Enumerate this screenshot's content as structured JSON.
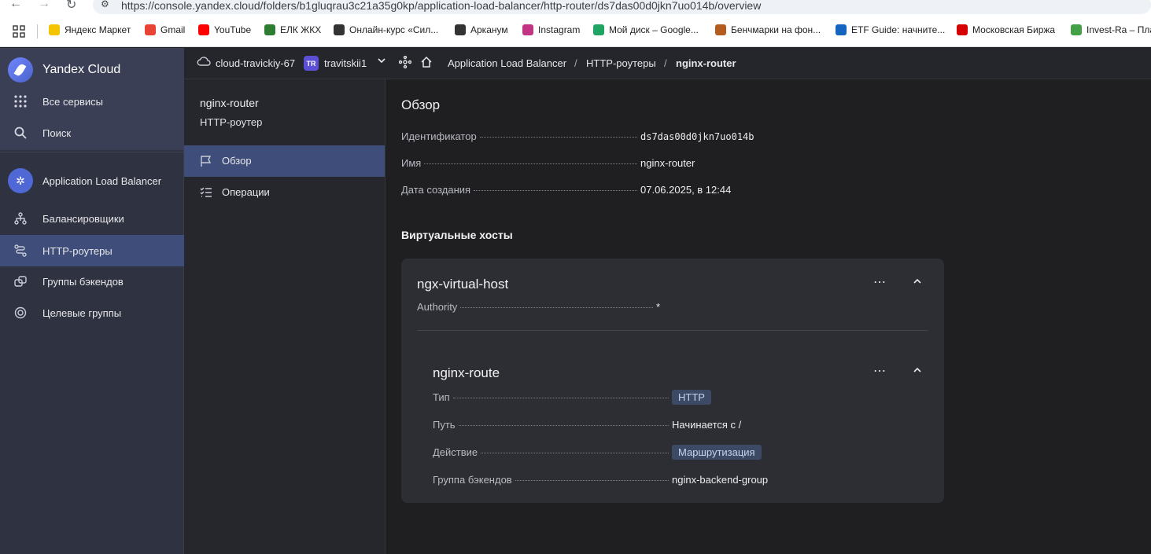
{
  "browser": {
    "url": "https://console.yandex.cloud/folders/b1gluqrau3c21a35g0kp/application-load-balancer/http-router/ds7das00d0jkn7uo014b/overview",
    "bookmarks": [
      {
        "label": "Яндекс Маркет",
        "icon": "yandex-market-icon",
        "color": "#f5c400"
      },
      {
        "label": "Gmail",
        "icon": "gmail-icon",
        "color": "#ea4335"
      },
      {
        "label": "YouTube",
        "icon": "youtube-icon",
        "color": "#ff0000"
      },
      {
        "label": "ЕЛК ЖКХ",
        "icon": "elk-icon",
        "color": "#2e7d32"
      },
      {
        "label": "Онлайн-курс «Сил...",
        "icon": "course-icon",
        "color": "#333333"
      },
      {
        "label": "Арканум",
        "icon": "arkanum-icon",
        "color": "#333333"
      },
      {
        "label": "Instagram",
        "icon": "instagram-icon",
        "color": "#c13584"
      },
      {
        "label": "Мой диск – Google...",
        "icon": "google-drive-icon",
        "color": "#1fa463"
      },
      {
        "label": "Бенчмарки на фон...",
        "icon": "benchmarks-icon",
        "color": "#b35c1e"
      },
      {
        "label": "ETF Guide: начните...",
        "icon": "etf-icon",
        "color": "#1565c0"
      },
      {
        "label": "Московская Биржа",
        "icon": "moex-icon",
        "color": "#d50000"
      },
      {
        "label": "Invest-Ra – Пла",
        "icon": "invest-ra-icon",
        "color": "#43a047"
      }
    ]
  },
  "sidebar": {
    "brand": "Yandex Cloud",
    "top_items": [
      {
        "label": "Все сервисы",
        "icon": "grid-icon"
      },
      {
        "label": "Поиск",
        "icon": "search-icon"
      }
    ],
    "service": {
      "label": "Application Load Balancer",
      "icon": "alb-icon"
    },
    "items": [
      {
        "label": "Балансировщики",
        "icon": "balancer-icon"
      },
      {
        "label": "HTTP-роутеры",
        "icon": "router-icon",
        "active": true
      },
      {
        "label": "Группы бэкендов",
        "icon": "backend-groups-icon"
      },
      {
        "label": "Целевые группы",
        "icon": "target-groups-icon"
      }
    ]
  },
  "header": {
    "cloud": "cloud-travickiy-67",
    "folder_badge": "TR",
    "folder": "travitskii1",
    "breadcrumbs": [
      "Application Load Balancer",
      "HTTP-роутеры",
      "nginx-router"
    ],
    "separator": "/"
  },
  "subsidebar": {
    "title": "nginx-router",
    "subtitle": "HTTP-роутер",
    "items": [
      {
        "label": "Обзор",
        "icon": "flag-icon",
        "active": true
      },
      {
        "label": "Операции",
        "icon": "operations-list-icon"
      }
    ]
  },
  "overview": {
    "heading": "Обзор",
    "fields": [
      {
        "key": "Идентификатор",
        "value": "ds7das00d0jkn7uo014b"
      },
      {
        "key": "Имя",
        "value": "nginx-router"
      },
      {
        "key": "Дата создания",
        "value": "07.06.2025, в 12:44"
      }
    ]
  },
  "virtual_hosts": {
    "heading": "Виртуальные хосты",
    "host": {
      "name": "ngx-virtual-host",
      "authority_key": "Authority",
      "authority_value": "*",
      "route": {
        "name": "nginx-route",
        "fields": [
          {
            "key": "Тип",
            "value": "HTTP"
          },
          {
            "key": "Путь",
            "value": "Начинается с /"
          },
          {
            "key": "Действие",
            "value": "Маршрутизация"
          },
          {
            "key": "Группа бэкендов",
            "value": "nginx-backend-group"
          }
        ]
      }
    }
  },
  "colors": {
    "accent": "#4f68d6",
    "active_item": "#3e4d7a",
    "link": "#7f9cf5"
  }
}
